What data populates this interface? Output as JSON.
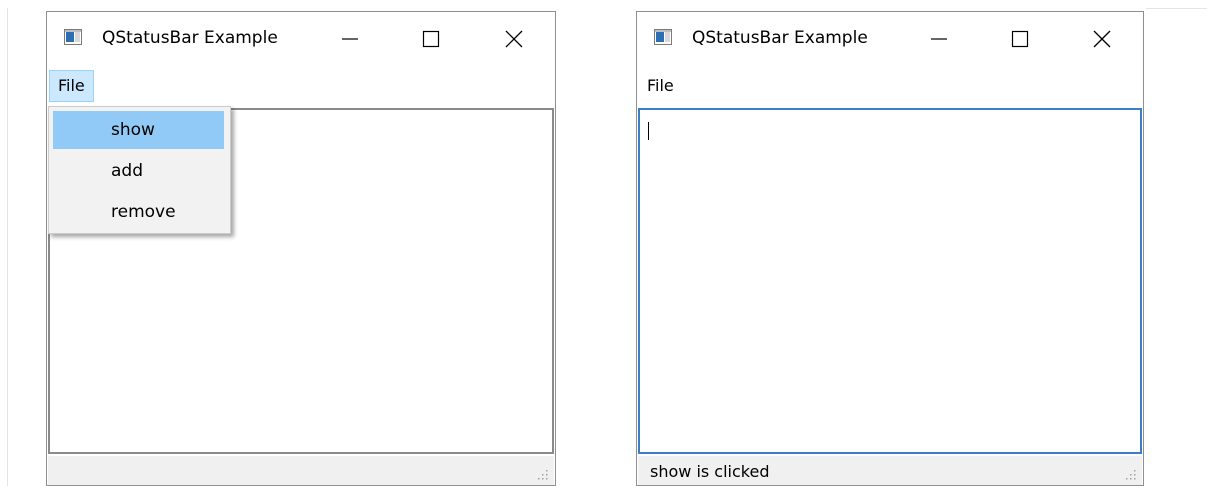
{
  "windows": [
    {
      "title": "QStatusBar Example",
      "menu": [
        "File"
      ],
      "status_text": ""
    },
    {
      "title": "QStatusBar Example",
      "menu": [
        "File"
      ],
      "status_text": "show is clicked"
    }
  ],
  "dropdown": {
    "items": [
      "show",
      "add",
      "remove"
    ],
    "highlighted": "show"
  },
  "colors": {
    "menu_highlight": "#cce8ff",
    "item_highlight": "#91c9f7",
    "focus_border": "#3c7fc4",
    "statusbar_bg": "#f0f0f0"
  }
}
